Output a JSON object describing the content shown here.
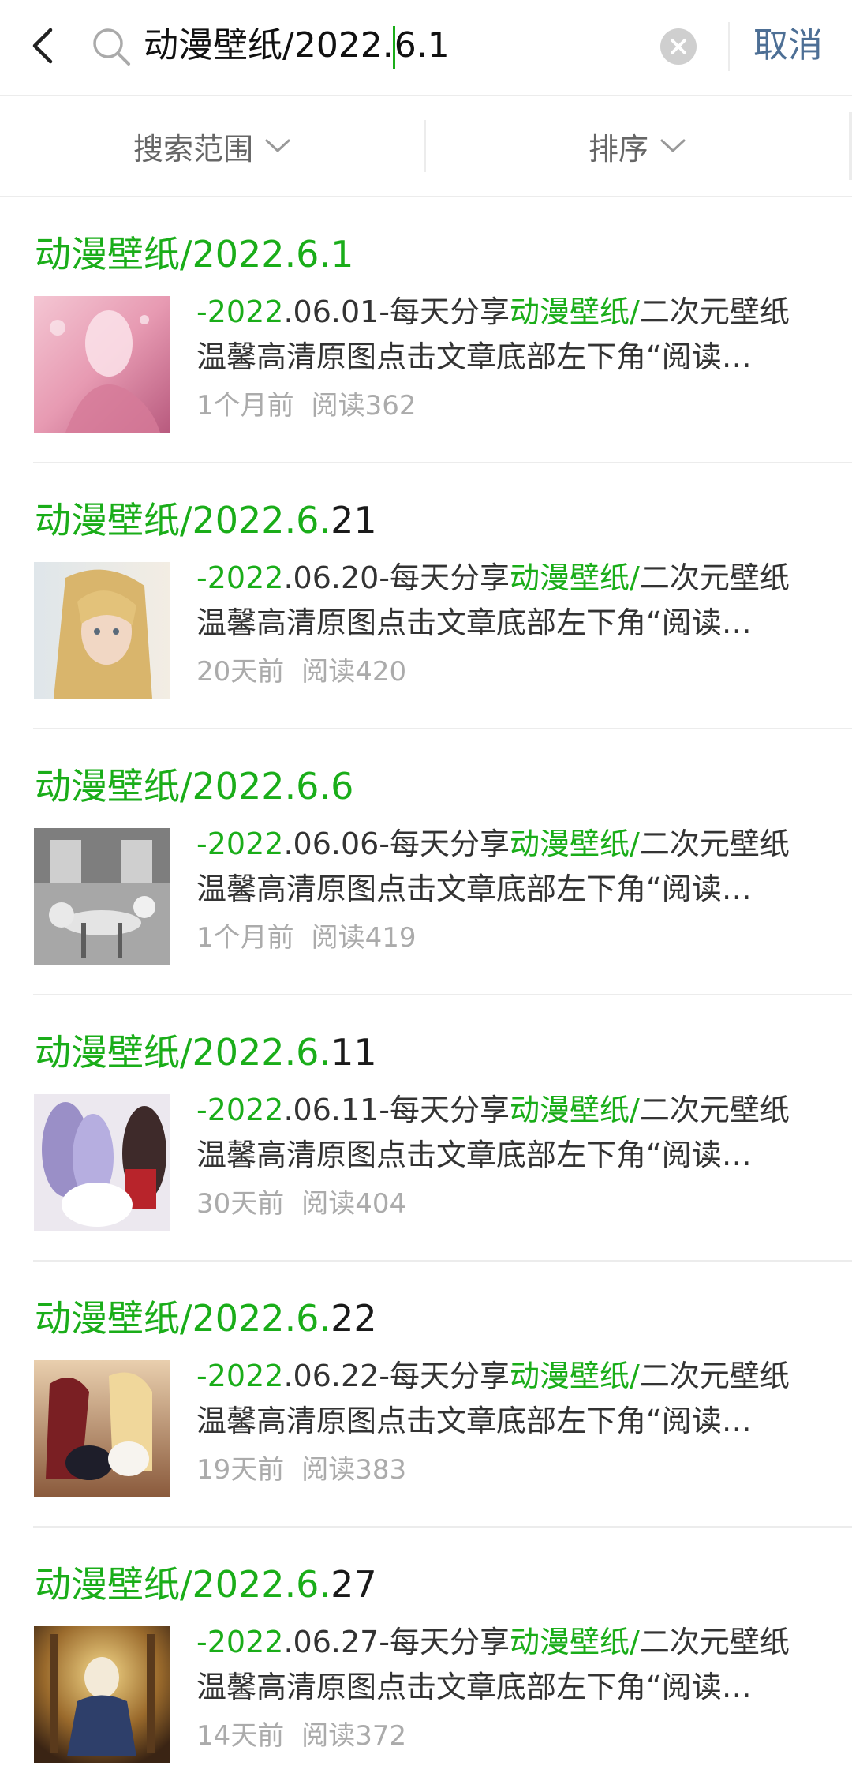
{
  "search": {
    "query_before_caret": "动漫壁纸/2022.",
    "query_after_caret": "6.1",
    "cancel_label": "取消"
  },
  "filters": {
    "scope_label": "搜索范围",
    "sort_label": "排序"
  },
  "colors": {
    "highlight": "#1aad19",
    "cancel": "#4d6f95",
    "meta": "#ababab"
  },
  "icons": [
    "back-arrow-icon",
    "search-icon",
    "clear-icon",
    "chevron-down-icon"
  ],
  "results": [
    {
      "title_match": "动漫壁纸/2022.6.1",
      "title_rest": "",
      "snippet_dash": "-",
      "snippet_year": "2022",
      "snippet_mid": ".06.01-每天分享",
      "snippet_kw": "动漫壁纸/",
      "snippet_tail": "二次元壁纸",
      "snippet_line2": "温馨高清原图点击文章底部左下角“阅读…",
      "time": "1个月前",
      "reads": "阅读362"
    },
    {
      "title_match": "动漫壁纸/2022.6.",
      "title_rest": "21",
      "snippet_dash": "-",
      "snippet_year": "2022",
      "snippet_mid": ".06.20-每天分享",
      "snippet_kw": "动漫壁纸/",
      "snippet_tail": "二次元壁纸",
      "snippet_line2": "温馨高清原图点击文章底部左下角“阅读…",
      "time": "20天前",
      "reads": "阅读420"
    },
    {
      "title_match": "动漫壁纸/2022.6.6",
      "title_rest": "",
      "snippet_dash": "-",
      "snippet_year": "2022",
      "snippet_mid": ".06.06-每天分享",
      "snippet_kw": "动漫壁纸/",
      "snippet_tail": "二次元壁纸",
      "snippet_line2": "温馨高清原图点击文章底部左下角“阅读…",
      "time": "1个月前",
      "reads": "阅读419"
    },
    {
      "title_match": "动漫壁纸/2022.6.",
      "title_rest": "11",
      "snippet_dash": "-",
      "snippet_year": "2022",
      "snippet_mid": ".06.11-每天分享",
      "snippet_kw": "动漫壁纸/",
      "snippet_tail": "二次元壁纸",
      "snippet_line2": "温馨高清原图点击文章底部左下角“阅读…",
      "time": "30天前",
      "reads": "阅读404"
    },
    {
      "title_match": "动漫壁纸/2022.6.",
      "title_rest": "22",
      "snippet_dash": "-",
      "snippet_year": "2022",
      "snippet_mid": ".06.22-每天分享",
      "snippet_kw": "动漫壁纸/",
      "snippet_tail": "二次元壁纸",
      "snippet_line2": "温馨高清原图点击文章底部左下角“阅读…",
      "time": "19天前",
      "reads": "阅读383"
    },
    {
      "title_match": "动漫壁纸/2022.6.",
      "title_rest": "27",
      "snippet_dash": "-",
      "snippet_year": "2022",
      "snippet_mid": ".06.27-每天分享",
      "snippet_kw": "动漫壁纸/",
      "snippet_tail": "二次元壁纸",
      "snippet_line2": "温馨高清原图点击文章底部左下角“阅读…",
      "time": "14天前",
      "reads": "阅读372"
    }
  ]
}
